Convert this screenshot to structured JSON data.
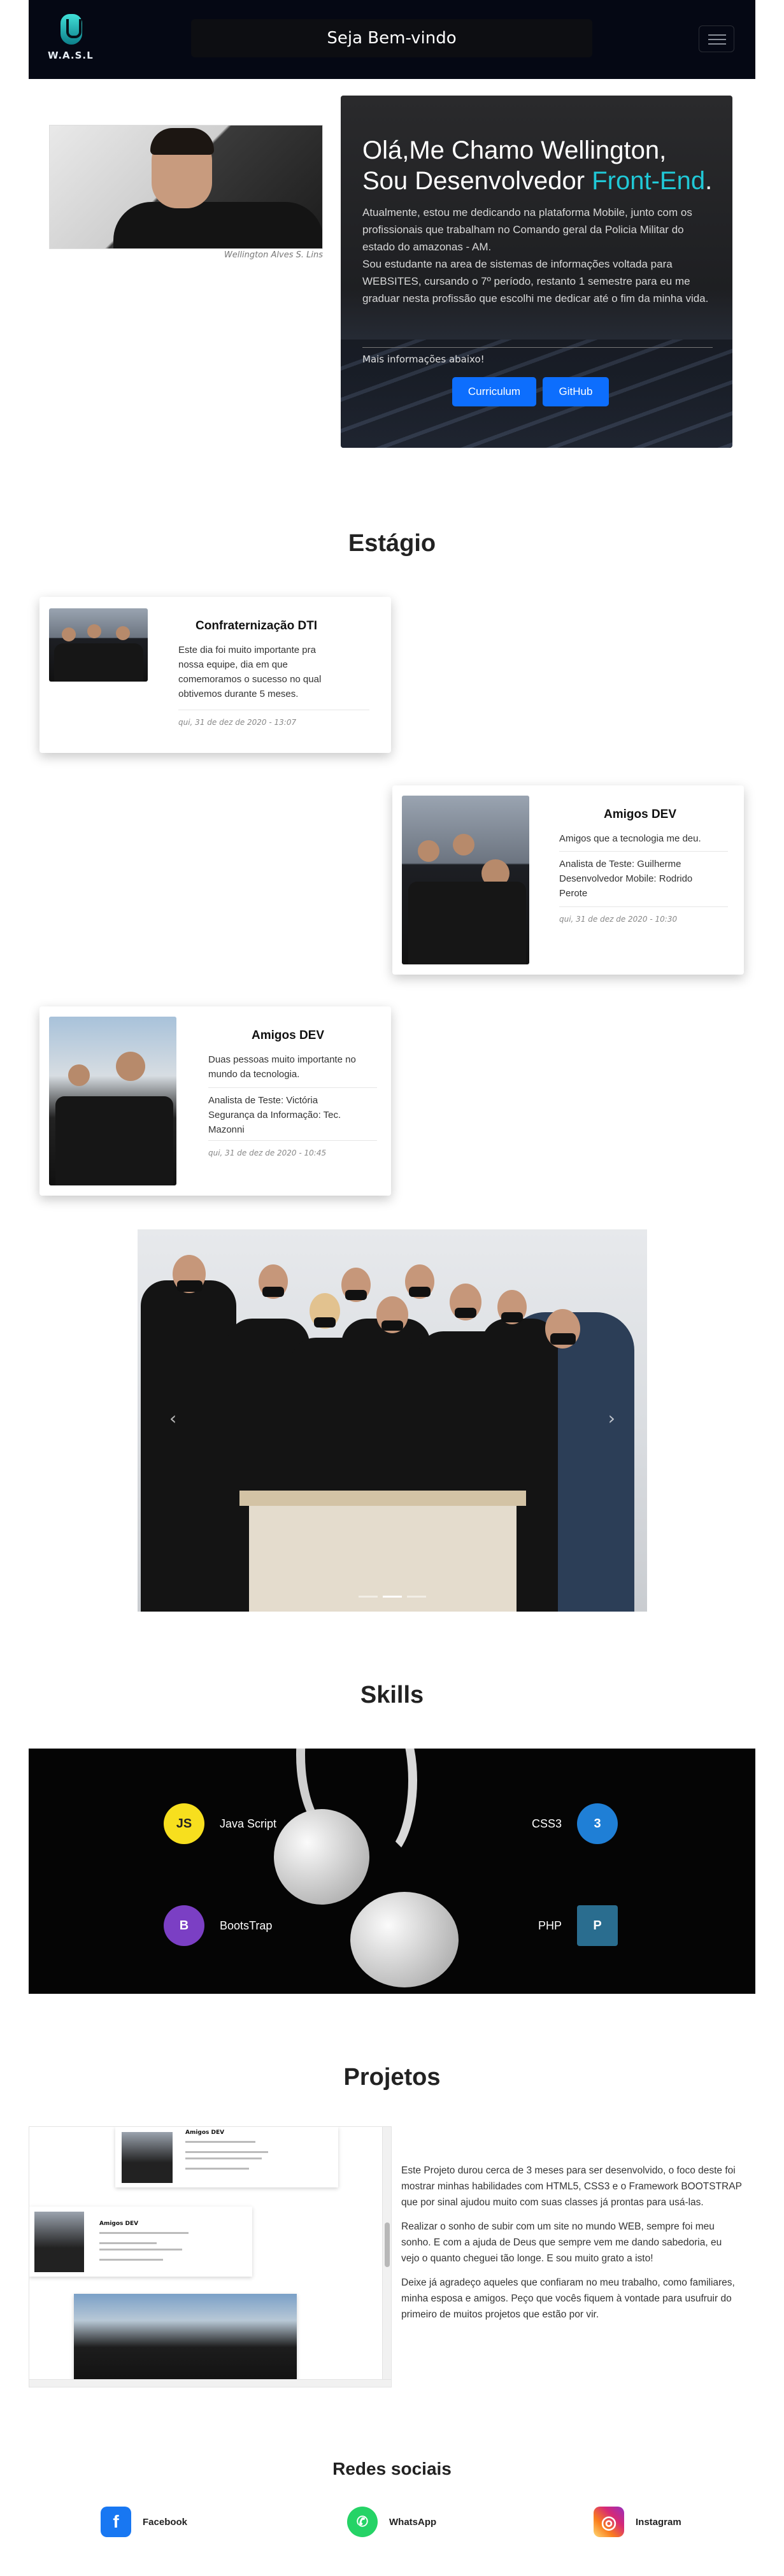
{
  "navbar": {
    "logo_text": "W.A.S.L",
    "title": "Seja Bem-vindo"
  },
  "hero": {
    "photo_caption": "Wellington Alves S. Lins",
    "heading_line1": "Olá,Me Chamo Wellington,",
    "heading_line2_prefix": "Sou Desenvolvedor ",
    "heading_accent": "Front-End",
    "heading_suffix": ".",
    "paragraph1": "Atualmente, estou me dedicando na plataforma Mobile, junto com os profissionais que trabalham no Comando geral da Policia Militar do estado do amazonas - AM.",
    "paragraph2": "Sou estudante na area de sistemas de informações voltada para WEBSITES, cursando o 7º período, restanto 1 semestre para eu me graduar nesta profissão que escolhi me dedicar até o fim da minha vida.",
    "more_info": "Mais informações abaixo!",
    "btn_curriculum": "Curriculum",
    "btn_github": "GitHub"
  },
  "estagio": {
    "title": "Estágio",
    "cards": [
      {
        "title": "Confraternização DTI",
        "text": "Este dia foi muito importante pra nossa equipe, dia em que comemoramos o sucesso no qual obtivemos durante 5 meses.",
        "date": "qui, 31 de dez de 2020 - 13:07"
      },
      {
        "title": "Amigos DEV",
        "text": "Amigos que a tecnologia me deu.",
        "text2": "Analista de Teste: Guilherme Desenvolvedor Mobile: Rodrido Perote",
        "date": "qui, 31 de dez de 2020 - 10:30"
      },
      {
        "title": "Amigos DEV",
        "text": "Duas pessoas muito importante no mundo da tecnologia.",
        "text2": "Analista de Teste: Victória Segurança da Informação: Tec. Mazonni",
        "date": "qui, 31 de dez de 2020 - 10:45"
      }
    ]
  },
  "carousel": {
    "prev": "‹",
    "next": "›",
    "slides": 3,
    "active_slide": 2
  },
  "skills": {
    "title": "Skills",
    "items": [
      {
        "label": "Java Script",
        "icon": "javascript-icon",
        "color": "#f7df1e"
      },
      {
        "label": "CSS3",
        "icon": "css3-icon",
        "color": "#1f7fd6"
      },
      {
        "label": "BootsTrap",
        "icon": "bootstrap-icon",
        "color": "#7b3fc4"
      },
      {
        "label": "PHP",
        "icon": "php-icon",
        "color": "#2a6d8f"
      }
    ]
  },
  "projetos": {
    "title": "Projetos",
    "paragraph1": "Este Projeto durou cerca de 3 meses para ser desenvolvido, o foco deste foi mostrar minhas habilidades com HTML5, CSS3 e o Framework BOOTSTRAP que por sinal ajudou muito com suas classes já prontas para usá-las.",
    "paragraph2": "Realizar o sonho de subir com um site no mundo WEB, sempre foi meu sonho. E com a ajuda de Deus que sempre vem me dando sabedoria, eu vejo o quanto cheguei tão longe. E sou muito grato a isto!",
    "paragraph3": "Deixe já agradeço aqueles que confiaram no meu trabalho, como familiares, minha esposa e amigos. Peço que vocês fiquem à vontade para usufruir do primeiro de muitos projetos que estão por vir.",
    "preview_card1_title": "Amigos DEV",
    "preview_card2_title": "Amigos DEV"
  },
  "social": {
    "title": "Redes sociais",
    "facebook": "Facebook",
    "whatsapp": "WhatsApp",
    "instagram": "Instagram",
    "colors": {
      "facebook": "#1877f2",
      "whatsapp": "#25d366",
      "instagram": "#d62976"
    }
  }
}
